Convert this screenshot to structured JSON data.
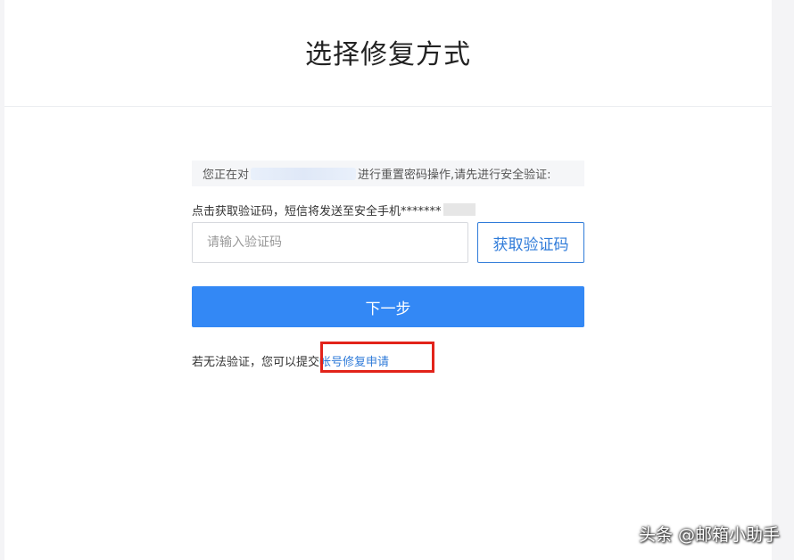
{
  "header": {
    "title": "选择修复方式"
  },
  "notice": {
    "prefix": "您正在对",
    "suffix": "进行重置密码操作,请先进行安全验证:"
  },
  "sms": {
    "text": "点击获取验证码，短信将发送至安全手机*******"
  },
  "code_input": {
    "placeholder": "请输入验证码",
    "value": ""
  },
  "buttons": {
    "get_code": "获取验证码",
    "next": "下一步"
  },
  "help": {
    "prefix": "若无法验证，您可以提交",
    "link": "帐号修复申请"
  },
  "watermark": {
    "text": "头条 @邮箱小助手"
  },
  "colors": {
    "primary": "#3388f5",
    "link": "#2f7bd9",
    "highlight": "#e2231a"
  }
}
